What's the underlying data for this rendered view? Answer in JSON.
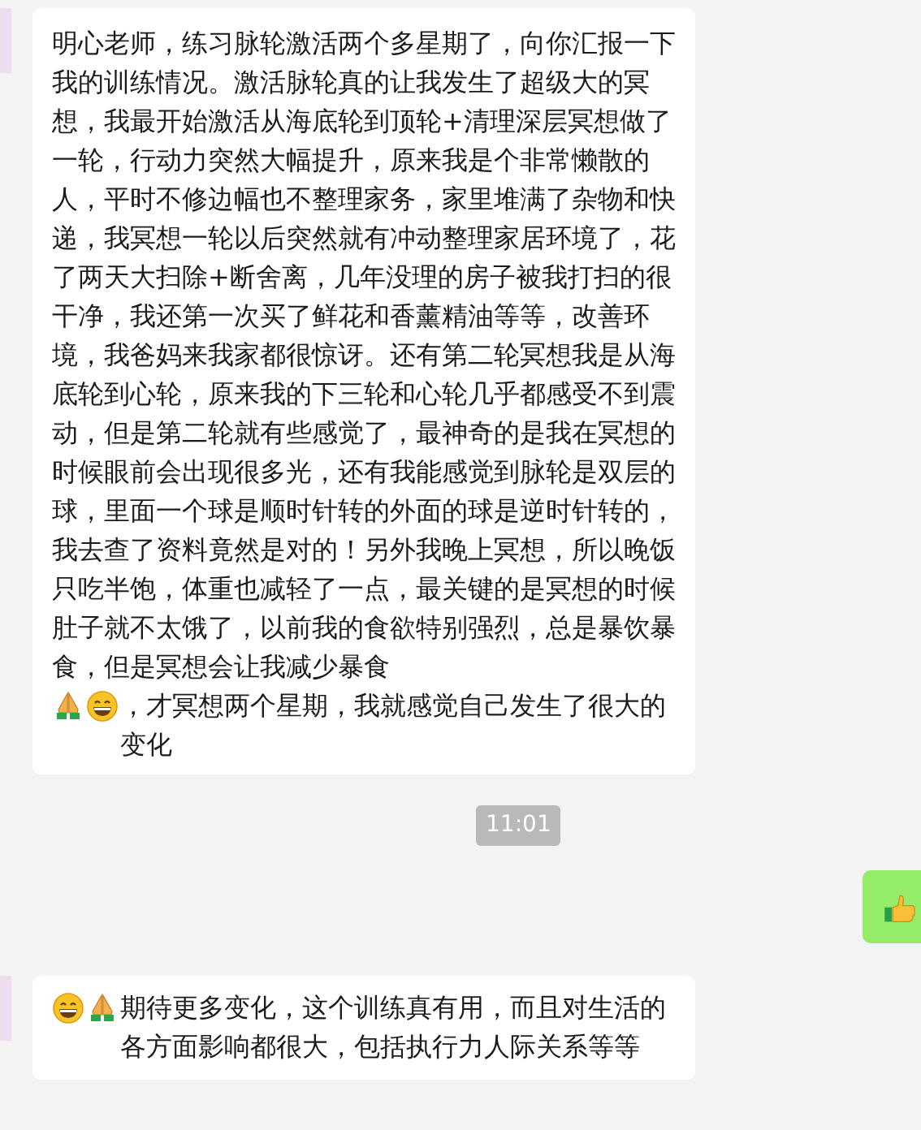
{
  "messages": [
    {
      "kind": "received",
      "parts": [
        {
          "kind": "text",
          "text": "明心老师，练习脉轮激活两个多星期了，向你汇报一下我的训练情况。激活脉轮真的让我发生了超级大的冥想，我最开始激活从海底轮到顶轮+清理深层冥想做了一轮，行动力突然大幅提升，原来我是个非常懒散的人，平时不修边幅也不整理家务，家里堆满了杂物和快递，我冥想一轮以后突然就有冲动整理家居环境了，花了两天大扫除+断舍离，几年没理的房子被我打扫的很干净，我还第一次买了鲜花和香薰精油等等，改善环境，我爸妈来我家都很惊讶。还有第二轮冥想我是从海底轮到心轮，原来我的下三轮和心轮几乎都感受不到震动，但是第二轮就有些感觉了，最神奇的是我在冥想的时候眼前会出现很多光，还有我能感觉到脉轮是双层的球，里面一个球是顺时针转的外面的球是逆时针转的，我去查了资料竟然是对的！另外我晚上冥想，所以晚饭只吃半饱，体重也减轻了一点，最关键的是冥想的时候肚子就不太饿了，以前我的食欲特别强烈，总是暴饮暴食，但是冥想会让我减少暴食"
        },
        {
          "kind": "pray"
        },
        {
          "kind": "grin"
        },
        {
          "kind": "text",
          "text": "，才冥想两个星期，我就感觉自己发生了很大的变化"
        }
      ]
    },
    {
      "kind": "time",
      "text": "11:01"
    },
    {
      "kind": "sent",
      "parts": [
        {
          "kind": "thumbsup"
        }
      ]
    },
    {
      "kind": "received",
      "parts": [
        {
          "kind": "grin"
        },
        {
          "kind": "pray"
        },
        {
          "kind": "text",
          "text": "期待更多变化，这个训练真有用，而且对生活的各方面影响都很大，包括执行力人际关系等等"
        }
      ]
    }
  ]
}
